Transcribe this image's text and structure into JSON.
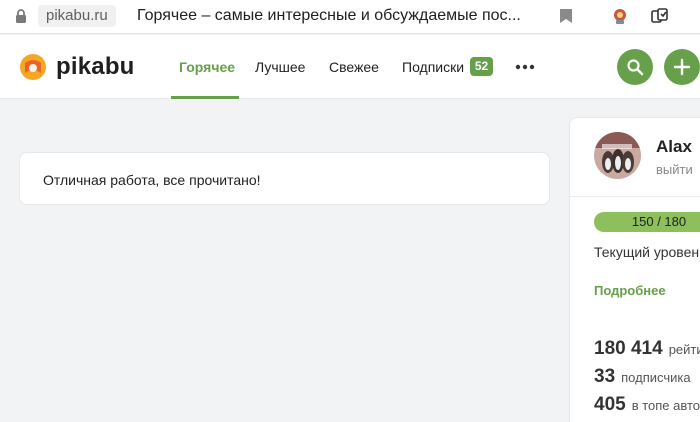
{
  "browser": {
    "url": "pikabu.ru",
    "tab_title": "Горячее – самые интересные и обсуждаемые пос..."
  },
  "header": {
    "logo_text": "pikabu",
    "nav": [
      {
        "label": "Горячее",
        "active": true
      },
      {
        "label": "Лучшее",
        "active": false
      },
      {
        "label": "Свежее",
        "active": false
      },
      {
        "label": "Подписки",
        "active": false
      }
    ],
    "subscriptions_badge": "52",
    "icons": {
      "more": "more-dots-icon",
      "search": "search-icon",
      "add": "plus-icon"
    }
  },
  "main": {
    "notice": "Отличная работа, все прочитано!"
  },
  "profile": {
    "name": "Alax",
    "logout": "выйти",
    "progress_text": "150 / 180",
    "progress_fraction": 0.83,
    "level_text": "Текущий уровень",
    "more_link": "Подробнее",
    "stats": [
      {
        "value": "180 414",
        "label": "рейтинг"
      },
      {
        "value": "33",
        "label": "подписчика"
      },
      {
        "value": "405",
        "label": "в топе авторов"
      }
    ]
  },
  "colors": {
    "accent": "#67a04a",
    "progress": "#8dc05c",
    "background": "#f2f3f5"
  }
}
